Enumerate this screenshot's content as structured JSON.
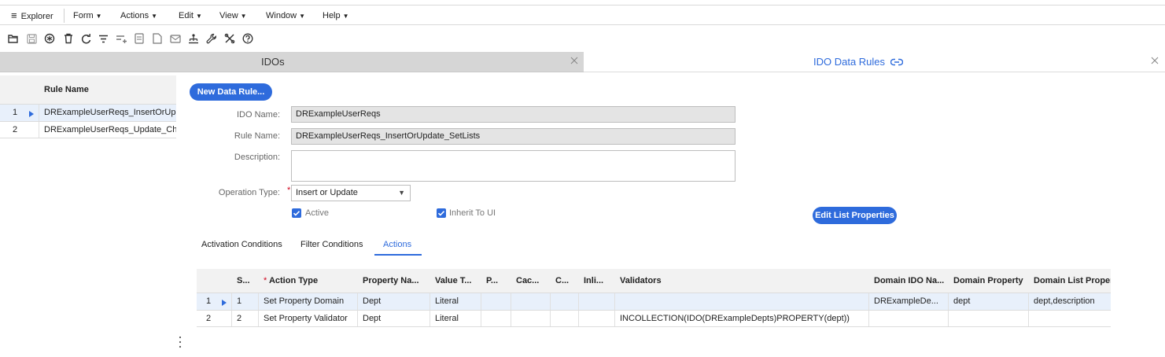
{
  "menubar": {
    "explorer": "Explorer",
    "items": [
      {
        "label": "Form"
      },
      {
        "label": "Actions"
      },
      {
        "label": "Edit"
      },
      {
        "label": "View"
      },
      {
        "label": "Window"
      },
      {
        "label": "Help"
      }
    ]
  },
  "toolbar": {
    "icons": [
      "open-folder-icon",
      "save-icon",
      "new-record-icon",
      "delete-icon",
      "refresh-icon",
      "filter-icon",
      "filter-in-place-icon",
      "form-icon",
      "document-icon",
      "mail-icon",
      "org-chart-icon",
      "wrench-icon",
      "tools-icon",
      "help-icon"
    ]
  },
  "tabs": {
    "idos": "IDOs",
    "rules": "IDO Data Rules"
  },
  "rule_list": {
    "header": "Rule Name",
    "rows": [
      {
        "num": "1",
        "name": "DRExampleUserReqs_InsertOrUp"
      },
      {
        "num": "2",
        "name": "DRExampleUserReqs_Update_Ch"
      }
    ]
  },
  "form": {
    "new_button": "New Data Rule...",
    "ido_name_label": "IDO Name:",
    "ido_name_value": "DRExampleUserReqs",
    "rule_name_label": "Rule Name:",
    "rule_name_value": "DRExampleUserReqs_InsertOrUpdate_SetLists",
    "description_label": "Description:",
    "description_value": "",
    "operation_label": "Operation Type:",
    "operation_value": "Insert or Update",
    "active_label": "Active",
    "inherit_label": "Inherit To UI",
    "edit_list_button": "Edit List Properties"
  },
  "subtabs": {
    "activation": "Activation Conditions",
    "filter": "Filter Conditions",
    "actions": "Actions"
  },
  "actions_grid": {
    "headers": [
      "S...",
      "Action Type",
      "Property Na...",
      "Value T...",
      "P...",
      "Cac...",
      "C...",
      "Inli...",
      "Validators",
      "Domain IDO Na...",
      "Domain Property",
      "Domain List Proper"
    ],
    "rows": [
      {
        "num": "1",
        "cells": [
          "1",
          "Set Property Domain",
          "Dept",
          "Literal",
          "",
          "",
          "",
          "",
          "",
          "DRExampleDe...",
          "dept",
          "dept,description"
        ]
      },
      {
        "num": "2",
        "cells": [
          "2",
          "Set Property Validator",
          "Dept",
          "Literal",
          "",
          "",
          "",
          "",
          "INCOLLECTION(IDO(DRExampleDepts)PROPERTY(dept))",
          "",
          "",
          ""
        ]
      }
    ]
  },
  "colors": {
    "accent": "#2e6bdc",
    "selected_row": "#e8f0fb",
    "required": "#d0021b"
  }
}
